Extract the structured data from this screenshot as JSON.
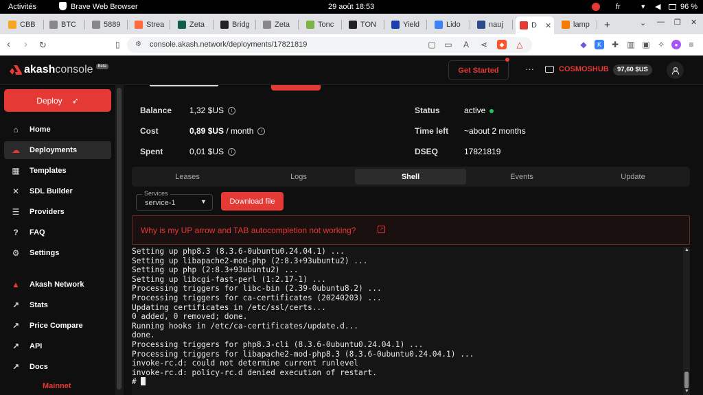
{
  "os": {
    "activities": "Activités",
    "app": "Brave Web Browser",
    "clock": "29 août  18:53",
    "lang": "fr",
    "battery": "96 %"
  },
  "tabs": [
    {
      "label": "CBB",
      "color": "#f5a623"
    },
    {
      "label": "BTC",
      "color": "#888"
    },
    {
      "label": "5889",
      "color": "#888"
    },
    {
      "label": "Strea",
      "color": "#ff6b3d"
    },
    {
      "label": "Zeta",
      "color": "#0f5e4c"
    },
    {
      "label": "Bridg",
      "color": "#222"
    },
    {
      "label": "Zeta",
      "color": "#888"
    },
    {
      "label": "Tonc",
      "color": "#7cb342"
    },
    {
      "label": "TON",
      "color": "#222"
    },
    {
      "label": "Yield",
      "color": "#1e40af"
    },
    {
      "label": "Lido",
      "color": "#3b82f6"
    },
    {
      "label": "nauj",
      "color": "#2b4a8b"
    },
    {
      "label": "D",
      "color": "#e53935"
    },
    {
      "label": "lamp",
      "color": "#f57c00"
    }
  ],
  "address": {
    "url": "console.akash.network/deployments/17821819"
  },
  "header": {
    "logo_bold": "akash",
    "logo_light": "console",
    "beta": "Beta",
    "get_started": "Get Started",
    "more": "···",
    "wallet": "COSMOSHUB",
    "balance": "97,60 $US"
  },
  "sidebar": {
    "deploy": "Deploy",
    "items": [
      {
        "label": "Home",
        "icon": "home-icon"
      },
      {
        "label": "Deployments",
        "icon": "cloud-icon"
      },
      {
        "label": "Templates",
        "icon": "grid-icon"
      },
      {
        "label": "SDL Builder",
        "icon": "tools-icon"
      },
      {
        "label": "Providers",
        "icon": "server-icon"
      },
      {
        "label": "FAQ",
        "icon": "help-icon"
      },
      {
        "label": "Settings",
        "icon": "gear-icon"
      },
      {
        "label": "Akash Network",
        "icon": "akash-icon"
      },
      {
        "label": "Stats",
        "icon": "external-link-icon"
      },
      {
        "label": "Price Compare",
        "icon": "external-link-icon"
      },
      {
        "label": "API",
        "icon": "external-link-icon"
      },
      {
        "label": "Docs",
        "icon": "external-link-icon"
      }
    ],
    "network": "Mainnet"
  },
  "details": {
    "balance_label": "Balance",
    "balance": "1,32 $US",
    "cost_label": "Cost",
    "cost": "0,89 $US",
    "cost_unit": " / month",
    "spent_label": "Spent",
    "spent": "0,01 $US",
    "status_label": "Status",
    "status": "active",
    "timeleft_label": "Time left",
    "timeleft": "~about 2 months",
    "dseq_label": "DSEQ",
    "dseq": "17821819"
  },
  "content_tabs": [
    "Leases",
    "Logs",
    "Shell",
    "Events",
    "Update"
  ],
  "shell": {
    "services_label": "Services",
    "service": "service-1",
    "download": "Download file",
    "help": "Why is my UP arrow and TAB autocompletion not working?",
    "lines": [
      "Setting up php8.3 (8.3.6-0ubuntu0.24.04.1) ...",
      "Setting up libapache2-mod-php (2:8.3+93ubuntu2) ...",
      "Setting up php (2:8.3+93ubuntu2) ...",
      "Setting up libcgi-fast-perl (1:2.17-1) ...",
      "Processing triggers for libc-bin (2.39-0ubuntu8.2) ...",
      "Processing triggers for ca-certificates (20240203) ...",
      "Updating certificates in /etc/ssl/certs...",
      "0 added, 0 removed; done.",
      "Running hooks in /etc/ca-certificates/update.d...",
      "done.",
      "Processing triggers for php8.3-cli (8.3.6-0ubuntu0.24.04.1) ...",
      "Processing triggers for libapache2-mod-php8.3 (8.3.6-0ubuntu0.24.04.1) ...",
      "invoke-rc.d: could not determine current runlevel",
      "invoke-rc.d: policy-rc.d denied execution of restart."
    ],
    "prompt": "# "
  }
}
